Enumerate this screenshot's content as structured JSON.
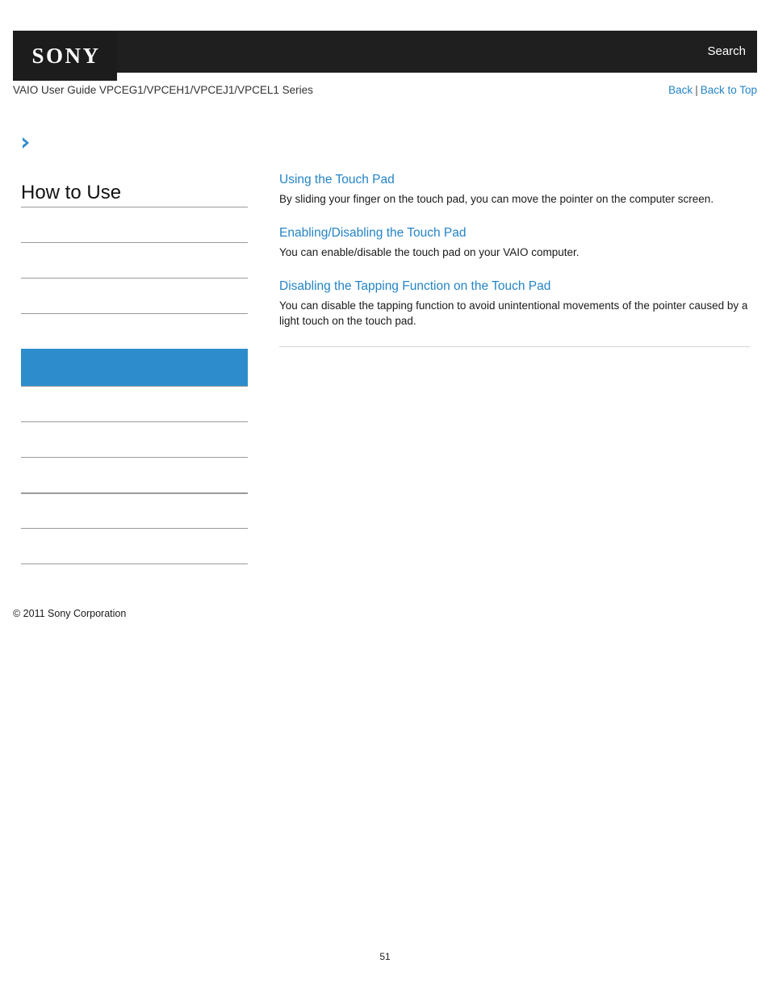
{
  "header": {
    "logo_text": "SONY",
    "search_label": "Search"
  },
  "subheader": {
    "guide_title": "VAIO User Guide VPCEG1/VPCEH1/VPCEJ1/VPCEL1 Series",
    "back_label": "Back",
    "separator": "|",
    "back_to_top_label": "Back to Top"
  },
  "sidebar": {
    "expand_icon": "chevron-right-icon",
    "title": "How to Use",
    "active_index": 4,
    "items": [
      {
        "label": ""
      },
      {
        "label": ""
      },
      {
        "label": ""
      },
      {
        "label": ""
      },
      {
        "label": ""
      },
      {
        "label": ""
      },
      {
        "label": ""
      },
      {
        "label": ""
      },
      {
        "label": ""
      },
      {
        "label": ""
      }
    ],
    "copyright": "© 2011 Sony Corporation"
  },
  "content": {
    "topics": [
      {
        "title": "Using the Touch Pad",
        "description": "By sliding your finger on the touch pad, you can move the pointer on the computer screen."
      },
      {
        "title": "Enabling/Disabling the Touch Pad",
        "description": "You can enable/disable the touch pad on your VAIO computer."
      },
      {
        "title": "Disabling the Tapping Function on the Touch Pad",
        "description": "You can disable the tapping function to avoid unintentional movements of the pointer caused by a light touch on the touch pad."
      }
    ]
  },
  "footer": {
    "page_number": "51"
  },
  "colors": {
    "link_blue": "#2484c6",
    "accent_blue": "#2d8dcc",
    "header_black": "#1f1f1f",
    "rule_gray": "#9a9a9a",
    "content_rule_gray": "#d4d4d4"
  }
}
